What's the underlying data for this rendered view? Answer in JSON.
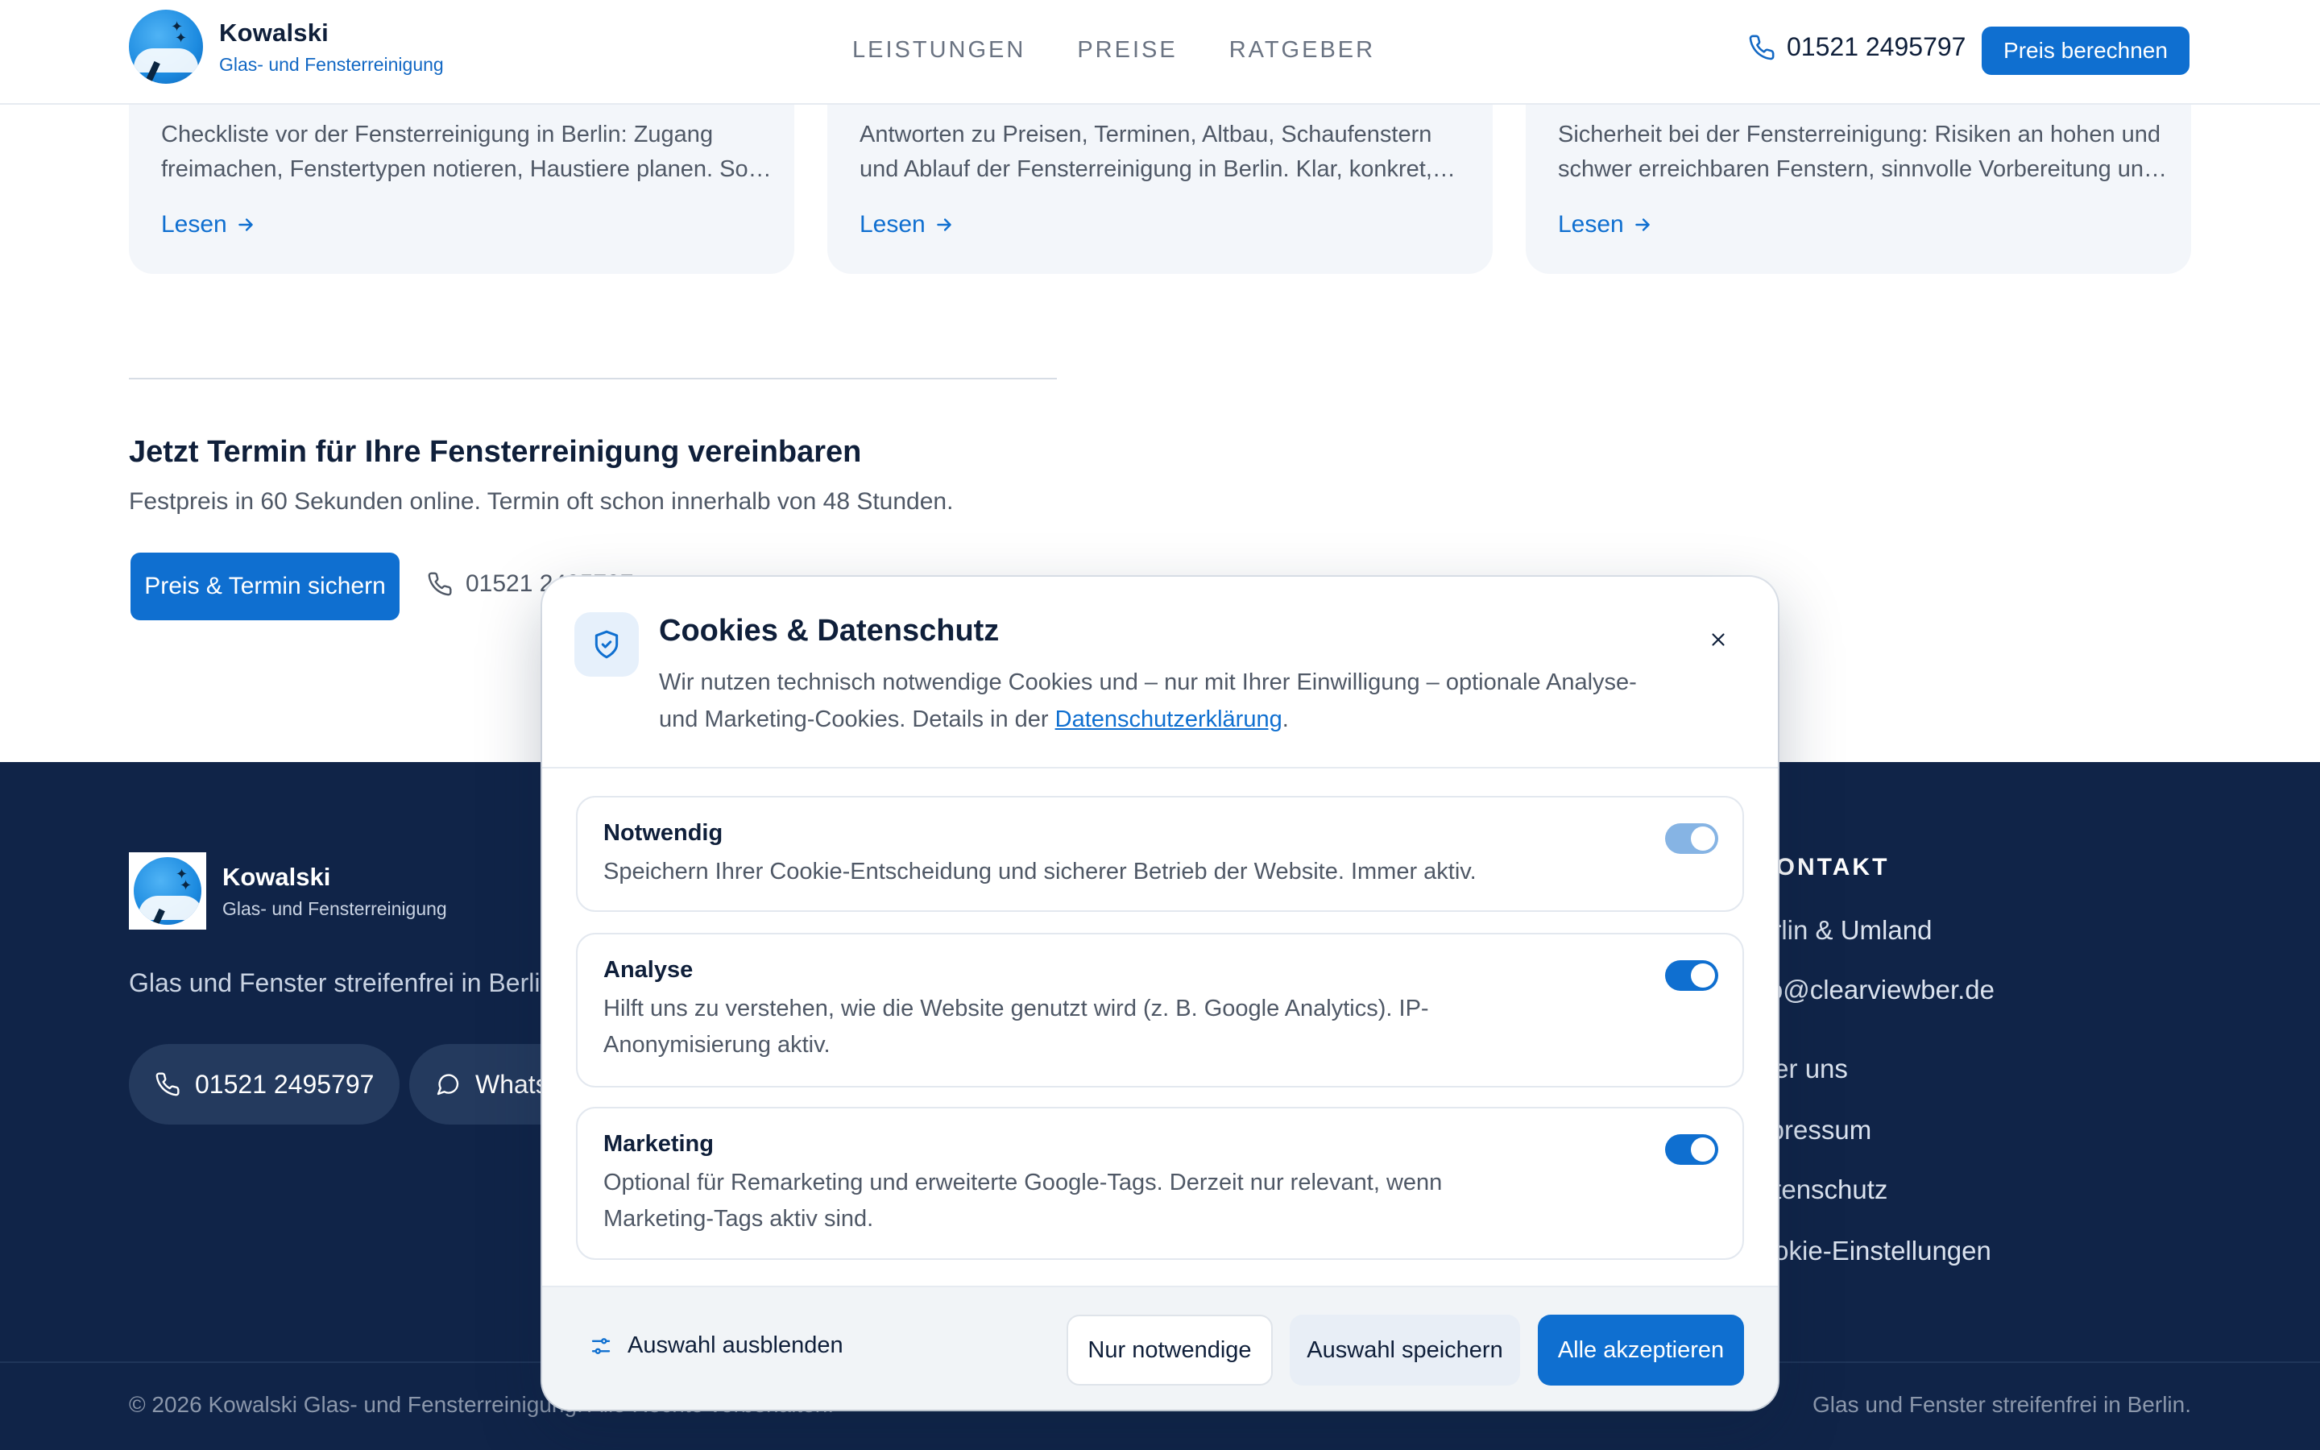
{
  "header": {
    "brand_name": "Kowalski",
    "brand_sub": "Glas- und Fensterreinigung",
    "nav": [
      "LEISTUNGEN",
      "PREISE",
      "RATGEBER"
    ],
    "phone": "01521 2495797",
    "cta": "Preis berechnen"
  },
  "cards": [
    {
      "text": "Checkliste vor der Fensterreinigung in Berlin: Zugang freimachen, Fenstertypen notieren, Haustiere planen. So…",
      "link": "Lesen"
    },
    {
      "text": "Antworten zu Preisen, Terminen, Altbau, Schaufenstern und Ablauf der Fensterreinigung in Berlin. Klar, konkret,…",
      "link": "Lesen"
    },
    {
      "text": "Sicherheit bei der Fensterreinigung: Risiken an hohen und schwer erreichbaren Fenstern, sinnvolle Vorbereitung un…",
      "link": "Lesen"
    }
  ],
  "cta": {
    "title": "Jetzt Termin für Ihre Fensterreinigung vereinbaren",
    "subtitle": "Festpreis in 60 Sekunden online. Termin oft schon innerhalb von 48 Stunden.",
    "button": "Preis & Termin sichern",
    "phone": "01521 2495797"
  },
  "footer": {
    "brand_name": "Kowalski",
    "brand_sub": "Glas- und Fensterreinigung",
    "tagline": "Glas und Fenster streifenfrei in Berlin.",
    "phone_pill": "01521 2495797",
    "whatsapp_pill": "WhatsApp",
    "contact_title": "KONTAKT",
    "location": "Berlin & Umland",
    "email": "info@clearviewber.de",
    "links": [
      "Über uns",
      "Impressum",
      "Datenschutz",
      "Cookie-Einstellungen"
    ],
    "copyright": "© 2026 Kowalski Glas- und Fensterreinigung. Alle Rechte vorbehalten.",
    "claim": "Glas und Fenster streifenfrei in Berlin."
  },
  "modal": {
    "title": "Cookies & Datenschutz",
    "desc_before": "Wir nutzen technisch notwendige Cookies und – nur mit Ihrer Einwilligung – optionale Analyse- und Marketing-Cookies. Details in der ",
    "desc_link": "Datenschutzerklärung",
    "desc_after": ".",
    "options": [
      {
        "title": "Notwendig",
        "desc": "Speichern Ihrer Cookie-Entscheidung und sicherer Betrieb der Website. Immer aktiv.",
        "enabled": true,
        "locked": true
      },
      {
        "title": "Analyse",
        "desc": "Hilft uns zu verstehen, wie die Website genutzt wird (z. B. Google Analytics). IP-Anonymisierung aktiv.",
        "enabled": true,
        "locked": false
      },
      {
        "title": "Marketing",
        "desc": "Optional für Remarketing und erweiterte Google-Tags. Derzeit nur relevant, wenn Marketing-Tags aktiv sind.",
        "enabled": true,
        "locked": false
      }
    ],
    "hide_selection": "Auswahl ausblenden",
    "btn_necessary": "Nur notwendige",
    "btn_save": "Auswahl speichern",
    "btn_accept": "Alle akzeptieren"
  },
  "colors": {
    "primary": "#0f6fd0",
    "footer_bg": "#102448",
    "card_bg": "#f3f6fa",
    "heading": "#0f1f3a"
  },
  "icons": [
    "phone-icon",
    "arrow-right-icon",
    "shield-check-icon",
    "close-icon",
    "sliders-icon",
    "whatsapp-icon",
    "logo-icon"
  ]
}
